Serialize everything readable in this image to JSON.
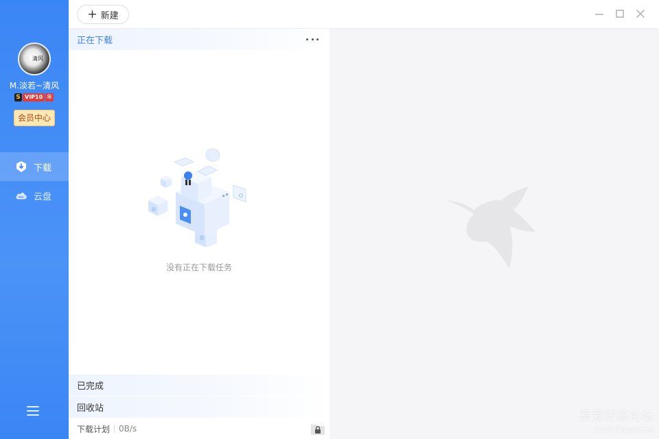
{
  "sidebar": {
    "username": "M.淡若~清风",
    "vip": {
      "s_label": "S",
      "badge": "VIP10",
      "year": "年"
    },
    "member_center": "会员中心",
    "nav": [
      {
        "label": "下载",
        "icon": "download-shield-icon",
        "active": true
      },
      {
        "label": "云盘",
        "icon": "cloud-icon",
        "active": false
      }
    ],
    "menu_icon": "hamburger-menu-icon"
  },
  "toolbar": {
    "new_label": "新建"
  },
  "window_controls": [
    "minimize-icon",
    "maximize-icon",
    "close-icon"
  ],
  "tasks": {
    "downloading": "正在下载",
    "empty_message": "没有正在下载任务",
    "completed": "已完成",
    "recycle": "回收站",
    "plan": "下载计划",
    "speed": "0B/s"
  },
  "watermark": {
    "title": "吾爱破解论坛",
    "url": "www.52pojie.cn"
  },
  "colors": {
    "sidebar": "#3b86f6",
    "accent": "#3c84f4",
    "member_bg": "#fde8b6",
    "vip_red": "#e23b3b"
  }
}
